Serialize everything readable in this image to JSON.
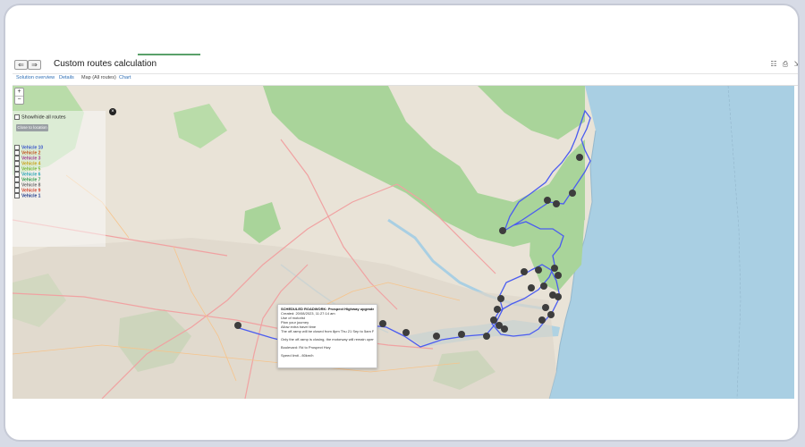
{
  "window": {
    "title": "Custom routes calculation",
    "back_glyph": "⇐",
    "forward_glyph": "⇒",
    "toolbar_icons": [
      "sitemap-icon",
      "print-icon",
      "export-icon"
    ]
  },
  "tabs": [
    {
      "label": "Solution overview"
    },
    {
      "label": "Details"
    },
    {
      "label": "Map (All routes)"
    },
    {
      "label": "Chart"
    }
  ],
  "map": {
    "zoom_in": "+",
    "zoom_out": "−",
    "colors": {
      "land": "#e9e3d7",
      "park": "#a9d49a",
      "water": "#a9cfe3",
      "route": "#4b5cf0",
      "road": "#f0a2a2",
      "marker": "#3d3d3d"
    },
    "panel": {
      "show_all_label": "Show/hide all routes",
      "button_label": "Close to location",
      "vehicles": [
        {
          "label": "Vehicle 10",
          "color": "#3a56c9"
        },
        {
          "label": "Vehicle 2",
          "color": "#c15520"
        },
        {
          "label": "Vehicle 3",
          "color": "#a33b8f"
        },
        {
          "label": "Vehicle 4",
          "color": "#c7a21b"
        },
        {
          "label": "Vehicle 5",
          "color": "#79b73a"
        },
        {
          "label": "Vehicle 6",
          "color": "#2aa6b4"
        },
        {
          "label": "Vehicle 7",
          "color": "#2e9c4a"
        },
        {
          "label": "Vehicle 8",
          "color": "#6b6b6b"
        },
        {
          "label": "Vehicle 9",
          "color": "#d2452e"
        },
        {
          "label": "Vehicle 1",
          "color": "#1f3a8a"
        }
      ]
    },
    "popup": {
      "title": "SCHEDULED ROADWORK: Prospect Highway upgrade",
      "created": "Created: 20/08/2023, 11:27:14 am",
      "line3": "Use of motorist",
      "line4": "Plan your journey",
      "line5": "Allow extra travel time",
      "line6": "The off-ramp will be closed from 8pm Thu 21 Sep to 5am Fri 22 Sep",
      "line7": "Only the off-ramp is closing, the motorway will remain open.",
      "line8": "Boulevard: Rd to Prospect Hwy",
      "line9": "Speed limit - 80km/h"
    }
  }
}
